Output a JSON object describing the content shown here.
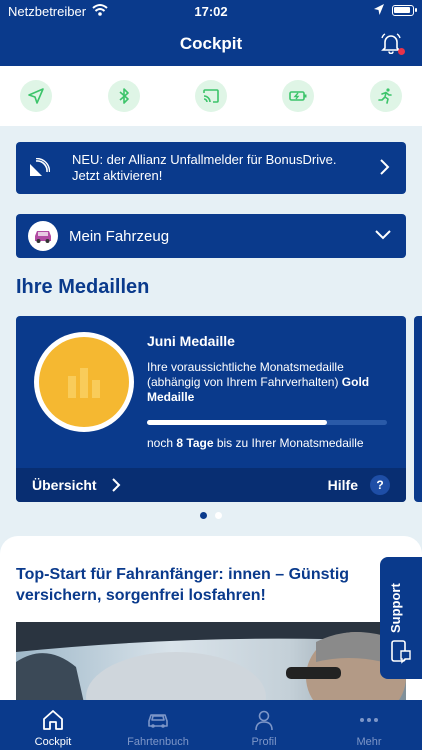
{
  "status_bar": {
    "carrier": "Netzbetreiber",
    "time": "17:02"
  },
  "header": {
    "title": "Cockpit"
  },
  "quick_actions": [
    {
      "icon": "location-arrow-icon"
    },
    {
      "icon": "bluetooth-icon"
    },
    {
      "icon": "cast-icon"
    },
    {
      "icon": "battery-charging-icon"
    },
    {
      "icon": "running-person-icon"
    }
  ],
  "banner": {
    "text": "NEU: der Allianz Unfallmelder für BonusDrive. Jetzt aktivieren!"
  },
  "vehicle": {
    "label": "Mein Fahrzeug"
  },
  "medals": {
    "title": "Ihre Medaillen",
    "card": {
      "title": "Juni Medaille",
      "desc_prefix": "Ihre voraussichtliche Monatsmedaille (abhängig von Ihrem Fahrverhalten)",
      "desc_medal": "Gold Medaille",
      "progress_percent": 75,
      "days_prefix": "noch",
      "days_value": "8 Tage",
      "days_suffix": "bis zu Ihrer Monatsmedaille",
      "overview_label": "Übersicht",
      "help_label": "Hilfe",
      "help_symbol": "?"
    },
    "pager": {
      "count": 2,
      "active": 0
    }
  },
  "promo": {
    "title": "Top-Start für Fahranfänger: innen – Günstig versichern, sorgenfrei losfahren!"
  },
  "support": {
    "label": "Support"
  },
  "tabs": [
    {
      "label": "Cockpit",
      "icon": "home-icon",
      "active": true
    },
    {
      "label": "Fahrtenbuch",
      "icon": "car-icon",
      "active": false
    },
    {
      "label": "Profil",
      "icon": "user-icon",
      "active": false
    },
    {
      "label": "Mehr",
      "icon": "more-dots-icon",
      "active": false
    }
  ],
  "colors": {
    "primary": "#0a3a8c",
    "background": "#e6f0f5",
    "medal_gold": "#f5b831",
    "quick_bg": "#dff5e6",
    "quick_icon": "#3cc46a"
  }
}
